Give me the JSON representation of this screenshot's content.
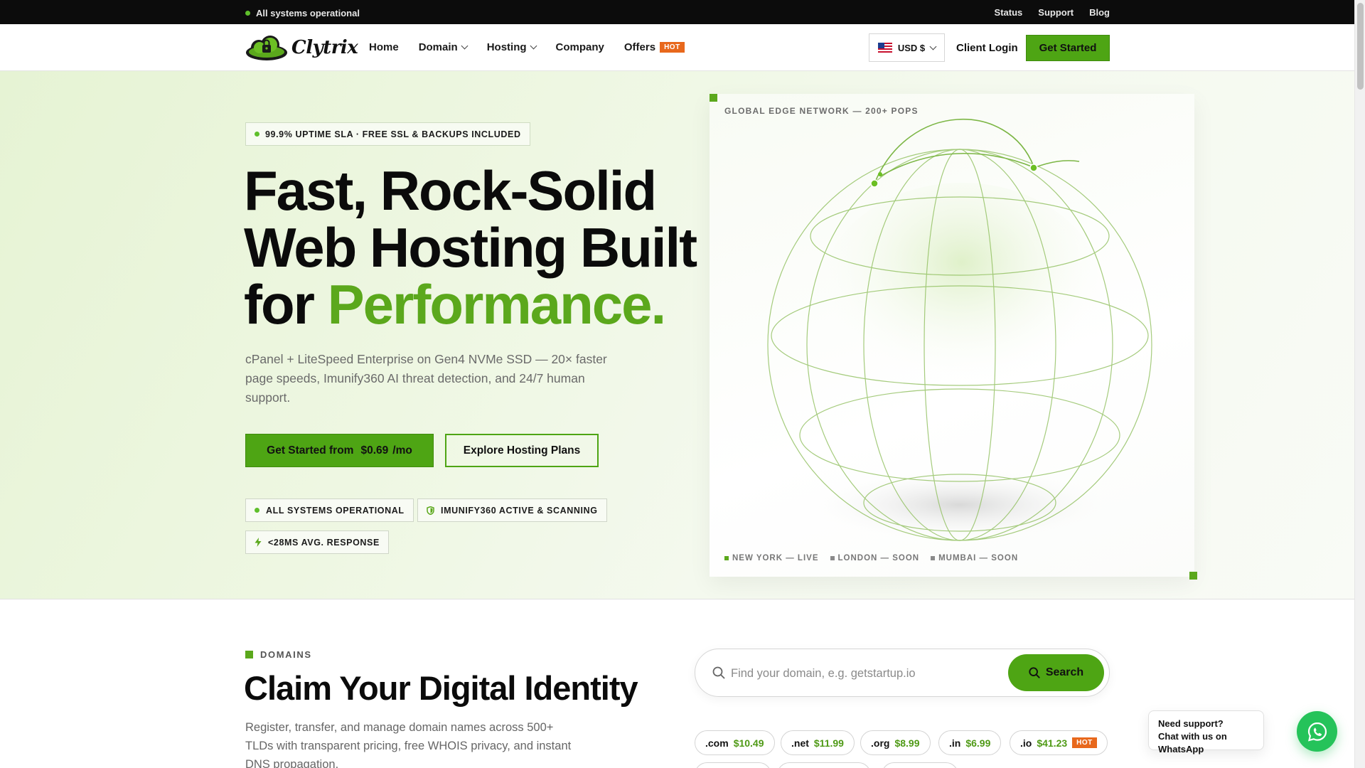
{
  "topbar": {
    "status": "All systems operational",
    "links": [
      "Status",
      "Support",
      "Blog"
    ]
  },
  "nav": {
    "brand": "Clytrix",
    "menu": [
      {
        "label": "Home",
        "dropdown": false
      },
      {
        "label": "Domain",
        "dropdown": true
      },
      {
        "label": "Hosting",
        "dropdown": true
      },
      {
        "label": "Company",
        "dropdown": false
      },
      {
        "label": "Offers",
        "dropdown": false,
        "badge": "HOT"
      }
    ],
    "currency": "USD $",
    "client_login": "Client Login",
    "get_started": "Get Started"
  },
  "hero": {
    "badge": "99.9% UPTIME SLA · FREE SSL & BACKUPS INCLUDED",
    "headline_line1": "Fast, Rock-Solid",
    "headline_line2": "Web Hosting Built",
    "headline_line3_prefix": "for ",
    "headline_line3_accent": "Performance.",
    "subtext": "cPanel + LiteSpeed Enterprise on Gen4 NVMe SSD — 20× faster page speeds, Imunify360 AI threat detection, and 24/7 human support.",
    "cta_primary_prefix": "Get Started from",
    "cta_primary_price": "$0.69",
    "cta_primary_suffix": "/mo",
    "cta_secondary": "Explore Hosting Plans",
    "chips": [
      "ALL SYSTEMS OPERATIONAL",
      "IMUNIFY360 ACTIVE & SCANNING",
      "<28MS AVG. RESPONSE"
    ]
  },
  "globe_panel": {
    "title": "GLOBAL EDGE NETWORK — 200+ POPS",
    "legend": [
      {
        "label": "NEW YORK — LIVE",
        "color": "#5ba81c"
      },
      {
        "label": "LONDON — SOON",
        "color": "#8a8a8a"
      },
      {
        "label": "MUMBAI — SOON",
        "color": "#8a8a8a"
      }
    ]
  },
  "domains": {
    "eyebrow": "DOMAINS",
    "title": "Claim Your Digital Identity",
    "text": "Register, transfer, and manage domain names across 500+ TLDs with transparent pricing, free WHOIS privacy, and instant DNS propagation.",
    "search_placeholder": "Find your domain, e.g. getstartup.io",
    "search_button": "Search",
    "tlds": [
      {
        "ext": ".com",
        "price": "$10.49"
      },
      {
        "ext": ".net",
        "price": "$11.99"
      },
      {
        "ext": ".org",
        "price": "$8.99"
      },
      {
        "ext": ".in",
        "price": "$6.99"
      },
      {
        "ext": ".io",
        "price": "$41.23",
        "badge": "HOT"
      }
    ]
  },
  "support": {
    "line1": "Need support?",
    "line2": "Chat with us on WhatsApp"
  },
  "colors": {
    "accent": "#4ea514",
    "accent_text": "#5ba81c",
    "hot": "#e8681c",
    "whatsapp": "#25c35a"
  }
}
